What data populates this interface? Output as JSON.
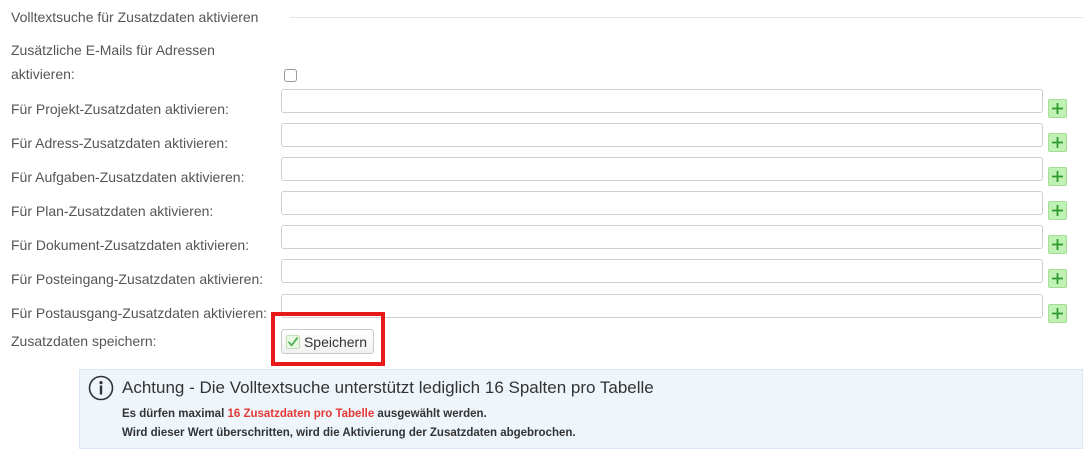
{
  "section": {
    "legend": "Volltextsuche für Zusatzdaten aktivieren"
  },
  "email_option": {
    "label_line1": "Zusätzliche E-Mails für Adressen",
    "label_line2": "aktivieren:",
    "checked": false
  },
  "fields": [
    {
      "label": "Für Projekt-Zusatzdaten aktivieren:",
      "value": ""
    },
    {
      "label": "Für Adress-Zusatzdaten aktivieren:",
      "value": ""
    },
    {
      "label": "Für Aufgaben-Zusatzdaten aktivieren:",
      "value": ""
    },
    {
      "label": "Für Plan-Zusatzdaten aktivieren:",
      "value": ""
    },
    {
      "label": "Für Dokument-Zusatzdaten aktivieren:",
      "value": ""
    },
    {
      "label": "Für Posteingang-Zusatzdaten aktivieren:",
      "value": ""
    },
    {
      "label": "Für Postausgang-Zusatzdaten aktivieren:",
      "value": ""
    }
  ],
  "save": {
    "label": "Zusatzdaten speichern:",
    "button_label": "Speichern",
    "icon": "check-icon"
  },
  "notice": {
    "icon": "info-icon",
    "title": "Achtung - Die Volltextsuche unterstützt lediglich 16 Spalten pro Tabelle",
    "line1_pre": "Es dürfen maximal ",
    "line1_highlight": "16 Zusatzdaten pro Tabelle",
    "line1_post": " ausgewählt werden.",
    "line2": "Wird dieser Wert überschritten, wird die Aktivierung der Zusatzdaten abgebrochen."
  },
  "colors": {
    "highlight_frame": "#e81919",
    "add_button": "#bff2b4",
    "add_icon": "#2e9a2e",
    "notice_background": "#eef5fb",
    "notice_highlight": "#e53935"
  }
}
